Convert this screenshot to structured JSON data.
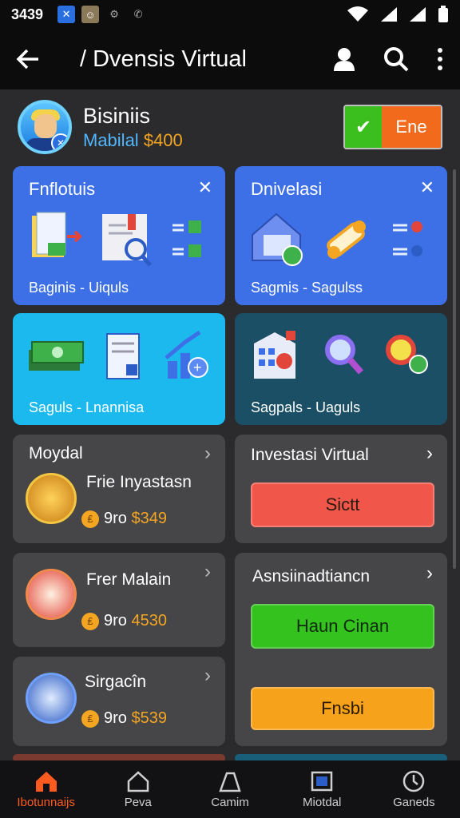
{
  "status": {
    "time": "3439"
  },
  "appbar": {
    "title": "/ Dvensis Virtual"
  },
  "profile": {
    "name": "Bisiniis",
    "subtitle_prefix": "Mabilal",
    "subtitle_amount": "$400",
    "toggle_label": "Ene"
  },
  "cards": [
    {
      "title": "Fnflotuis",
      "footer": "Baginis - Uiquls",
      "color": "#3d6fe6"
    },
    {
      "title": "Dnivelasi",
      "footer": "Sagmis - Sagulss",
      "color": "#3d6fe6"
    },
    {
      "title": "",
      "footer": "Saguls - Lnannisa",
      "color": "#1cb9ef"
    },
    {
      "title": "",
      "footer": "Sagpals - Uaguls",
      "color": "#1a4f66"
    }
  ],
  "left_list": {
    "header": "Moydal",
    "items": [
      {
        "title": "Frie Inyastasn",
        "price_prefix": "9ro",
        "price": "$349"
      },
      {
        "title": "Frer Malain",
        "price_prefix": "9ro",
        "price": "4530"
      },
      {
        "title": "Sirgacîn",
        "price_prefix": "9ro",
        "price": "$539"
      }
    ]
  },
  "right_panels": [
    {
      "title": "Investasi Virtual",
      "button": "Sictt",
      "button_color": "#f0574a"
    },
    {
      "title": "Asnsiinadtiancn",
      "button": "Haun Cinan",
      "button_color": "#34c21f",
      "button2": "Fnsbi",
      "button2_color": "#f7a21b"
    }
  ],
  "nav": [
    {
      "label": "Ibotunnaijs",
      "icon": "home-icon",
      "active": true
    },
    {
      "label": "Peva",
      "icon": "house-outline-icon"
    },
    {
      "label": "Camim",
      "icon": "tent-icon"
    },
    {
      "label": "Miotdal",
      "icon": "frame-icon"
    },
    {
      "label": "Ganeds",
      "icon": "clock-icon"
    }
  ]
}
